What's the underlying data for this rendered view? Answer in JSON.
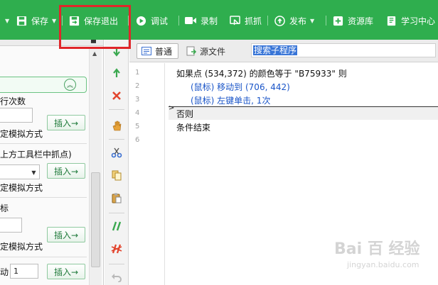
{
  "toolbar": {
    "items": [
      {
        "label": "保存"
      },
      {
        "label": "保存退出"
      },
      {
        "label": "调试"
      },
      {
        "label": "录制"
      },
      {
        "label": "抓抓"
      },
      {
        "label": "发布"
      },
      {
        "label": "资源库"
      },
      {
        "label": "学习中心"
      }
    ]
  },
  "left_panel": {
    "rows": [
      {
        "label": "行次数"
      },
      {
        "label": "定模拟方式"
      },
      {
        "label": "上方工具栏中抓点)"
      },
      {
        "label": "定模拟方式"
      },
      {
        "label": "标"
      },
      {
        "label": "定模拟方式"
      },
      {
        "label": "动"
      }
    ],
    "insert_label": "插入→",
    "input_value": "1"
  },
  "tabs": {
    "normal": "普通",
    "source": "源文件"
  },
  "search": {
    "value": "搜索子程序"
  },
  "editor": {
    "line_numbers": [
      "1",
      "2",
      "3",
      "4",
      "5",
      "6"
    ],
    "lines": [
      "如果点 (534,372) 的颜色等于 \"B75933\" 则",
      "(鼠标) 移动到 (706, 442)",
      "(鼠标) 左键单击, 1次",
      "否则",
      "条件结束"
    ]
  },
  "watermark": {
    "brand": "Bai 百 经验",
    "url": "jingyan.baidu.com"
  },
  "colors": {
    "toolbar_bg": "#2fae4e",
    "highlight_box": "#e0262a",
    "code_blue": "#1a55c8"
  }
}
